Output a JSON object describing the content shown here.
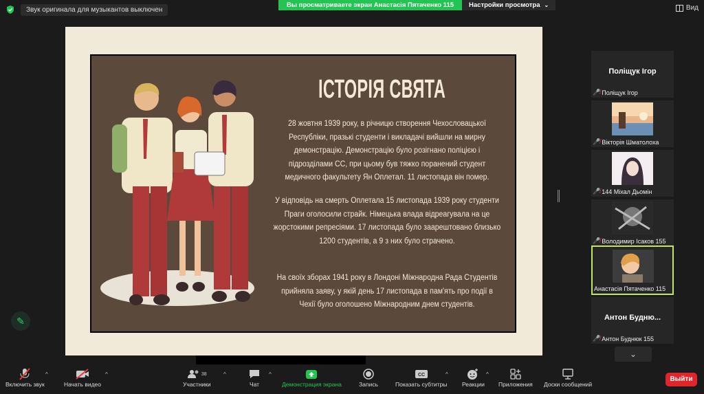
{
  "top": {
    "notice": "Звук оригинала для музыкантов выключен",
    "share_banner": "Вы просматриваете экран Анастасія Пятаченко 115",
    "view_settings": "Настройки просмотра",
    "view": "Вид"
  },
  "slide": {
    "title": "ІСТОРІЯ СВЯТА",
    "para1": "28 жовтня 1939 року, в річницю створення Чехословацької Республіки, празькі студенти і викладачі вийшли на мирну демонстрацію. Демонстрацію було розігнано поліцією і підрозділами СС, при цьому був тяжко поранений студент медичного факультету Ян Оплетал. 11 листопада він помер.",
    "para2": "У відповідь на смерть Оплетала 15 листопада 1939 року студенти Праги оголосили страйк. Німецька влада відреагувала на це жорстокими репресіями. 17 листопада було заарештовано близько 1200 студентів, а 9 з них було страчено.",
    "para3": "На своїх зборах 1941 року в Лондоні Міжнародна Рада Студентів прийняла заяву, у якій день 17 листопада в пам'ять про події в Чехії було оголошено Міжнародним днем студентів."
  },
  "participants": [
    {
      "display": "Поліщук Ігор",
      "name": "Поліщук Ігор"
    },
    {
      "name": "Вікторія Шматолоха"
    },
    {
      "name": "144 Міхал Дьомін"
    },
    {
      "name": "Володимир Ісаков 155"
    },
    {
      "name": "Анастасія Пятаченко 115"
    },
    {
      "display": "Антон Будню...",
      "name": "Антон Буднюк 155"
    }
  ],
  "toolbar": {
    "mic": "Включить звук",
    "video": "Начать видео",
    "participants": "Участники",
    "participants_count": "38",
    "chat": "Чат",
    "share": "Демонстрация экрана",
    "record": "Запись",
    "subtitles": "Показать субтитры",
    "reactions": "Реакции",
    "apps": "Приложения",
    "whiteboards": "Доски сообщений",
    "exit": "Выйти"
  },
  "colors": {
    "share_green": "#23c552",
    "exit_red": "#e0262a",
    "slide_bg": "#5b4a3c",
    "active_border": "#c5e36a"
  }
}
